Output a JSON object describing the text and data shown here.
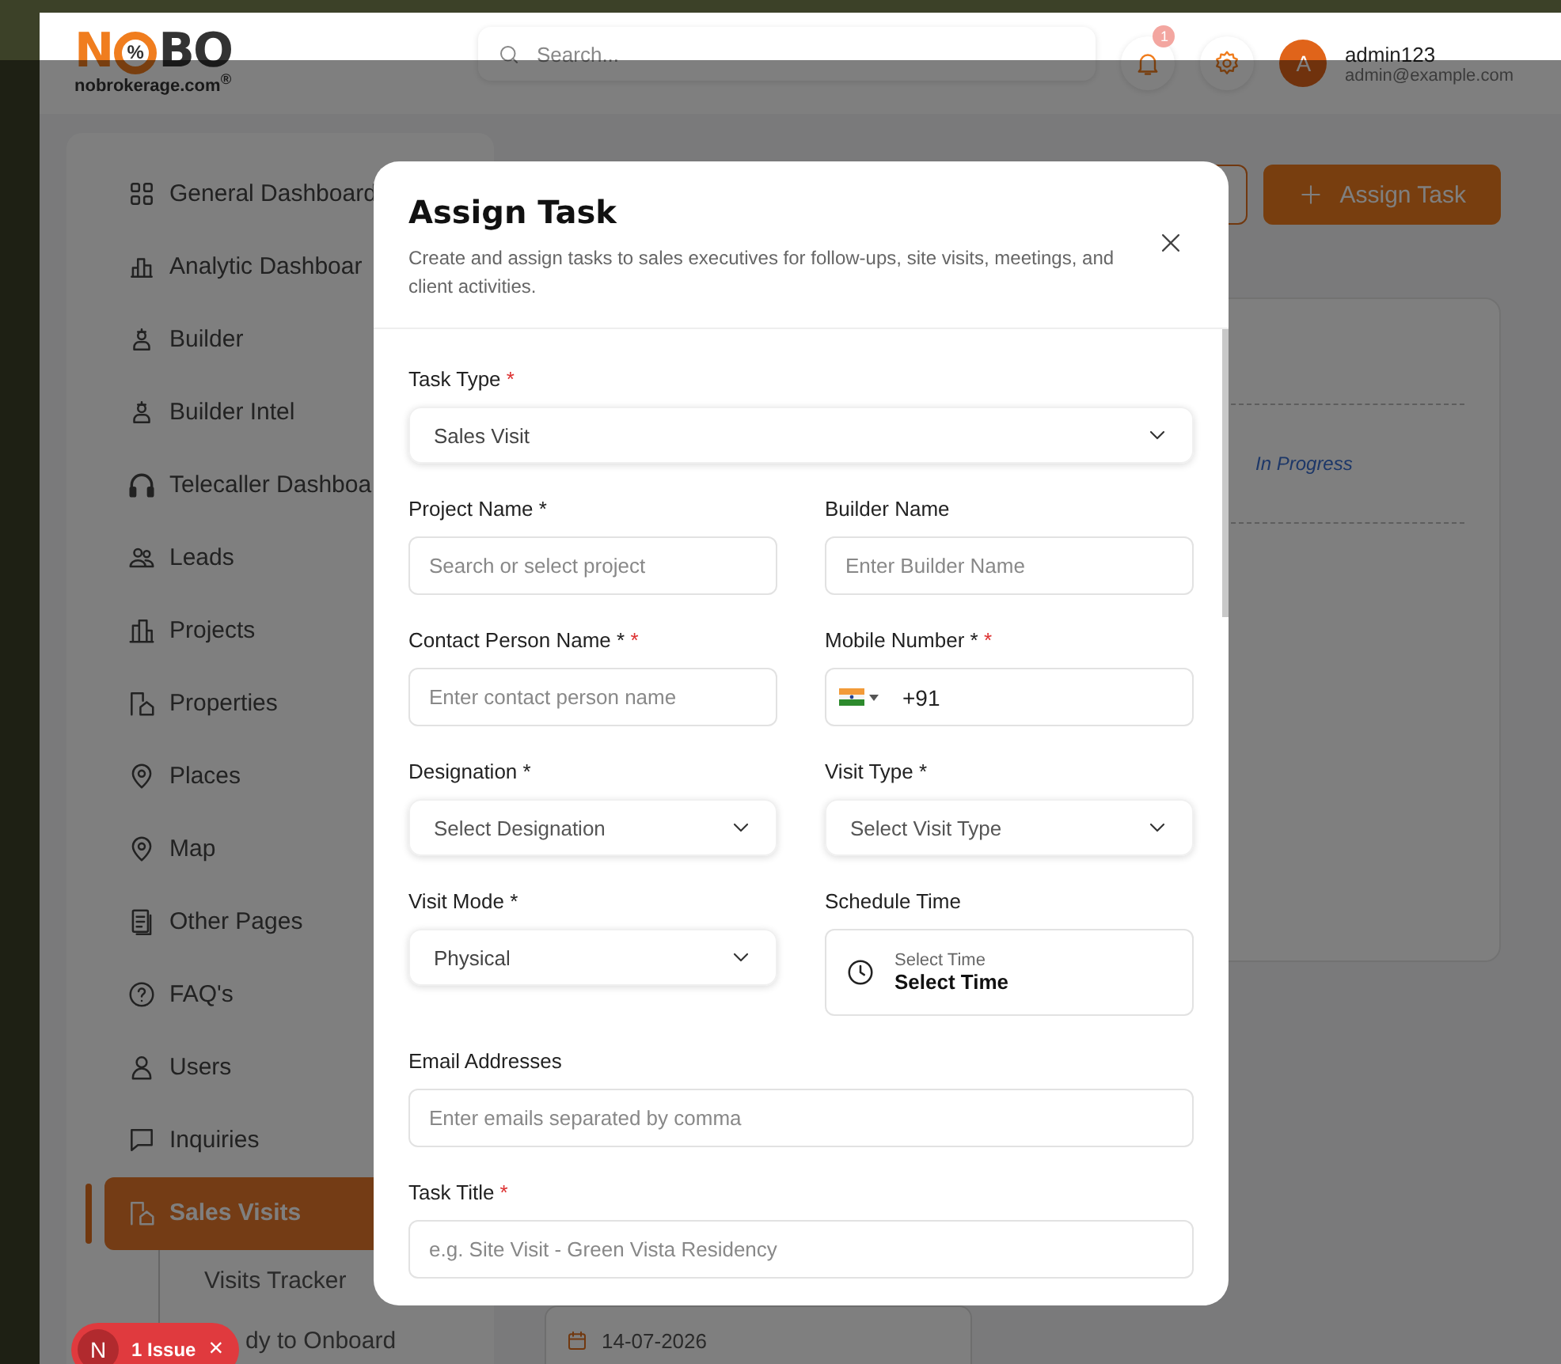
{
  "header": {
    "logo": {
      "first": "N",
      "badge": "%",
      "rest": "BO",
      "domain": "nobrokerage.com",
      "mark": "®"
    },
    "search": {
      "placeholder": "Search..."
    },
    "notifications": {
      "count": "1"
    },
    "user": {
      "avatar": "A",
      "name": "admin123",
      "email": "admin@example.com"
    }
  },
  "sidebar": {
    "items": [
      {
        "label": "General Dashboard",
        "selected": false
      },
      {
        "label": "Analytic Dashboar",
        "selected": false
      },
      {
        "label": "Builder",
        "selected": false
      },
      {
        "label": "Builder Intel",
        "selected": false
      },
      {
        "label": "Telecaller Dashboa",
        "selected": false
      },
      {
        "label": "Leads",
        "selected": false
      },
      {
        "label": "Projects",
        "selected": false
      },
      {
        "label": "Properties",
        "selected": false
      },
      {
        "label": "Places",
        "selected": false
      },
      {
        "label": "Map",
        "selected": false
      },
      {
        "label": "Other Pages",
        "selected": false
      },
      {
        "label": "FAQ's",
        "selected": false
      },
      {
        "label": "Users",
        "selected": false
      },
      {
        "label": "Inquiries",
        "selected": false
      },
      {
        "label": "Sales Visits",
        "selected": true,
        "children": [
          {
            "label": "Visits Tracker"
          },
          {
            "label": "dy to Onboard"
          }
        ]
      }
    ]
  },
  "page": {
    "primary_button": {
      "label": "Assign Task"
    },
    "status": "In Progress",
    "date": "14-07-2026"
  },
  "modal": {
    "title": "Assign Task",
    "required_mark": "*",
    "subtitle": "Create and assign tasks to sales executives for follow-ups, site visits, meetings, and client activities.",
    "rows": [
      [
        {
          "kind": "select",
          "label": "Task Type",
          "required": true,
          "value": "Sales Visit"
        }
      ],
      [
        {
          "kind": "input",
          "label": "Project Name *",
          "required": false,
          "placeholder": "Search or select project"
        },
        {
          "kind": "input",
          "label": "Builder Name",
          "required": false,
          "placeholder": "Enter Builder Name"
        }
      ],
      [
        {
          "kind": "input",
          "label": "Contact Person Name *",
          "required": true,
          "placeholder": "Enter contact person name"
        },
        {
          "kind": "phone",
          "label": "Mobile Number *",
          "required": true,
          "value": "+91"
        }
      ],
      [
        {
          "kind": "select",
          "label": "Designation *",
          "required": false,
          "placeholder": "Select Designation"
        },
        {
          "kind": "select",
          "label": "Visit Type *",
          "required": false,
          "placeholder": "Select Visit Type"
        }
      ],
      [
        {
          "kind": "select",
          "label": "Visit Mode *",
          "required": false,
          "value": "Physical"
        },
        {
          "kind": "time",
          "label": "Schedule Time",
          "required": false,
          "hint": "Select Time",
          "value": "Select Time"
        }
      ],
      [
        {
          "kind": "input",
          "label": "Email Addresses",
          "required": false,
          "placeholder": "Enter emails separated by comma"
        }
      ],
      [
        {
          "kind": "input",
          "label": "Task Title",
          "required": true,
          "placeholder": "e.g. Site Visit - Green Vista Residency"
        }
      ]
    ]
  },
  "issue_badge": {
    "logo": "N",
    "label": "1 Issue",
    "close": "×"
  }
}
